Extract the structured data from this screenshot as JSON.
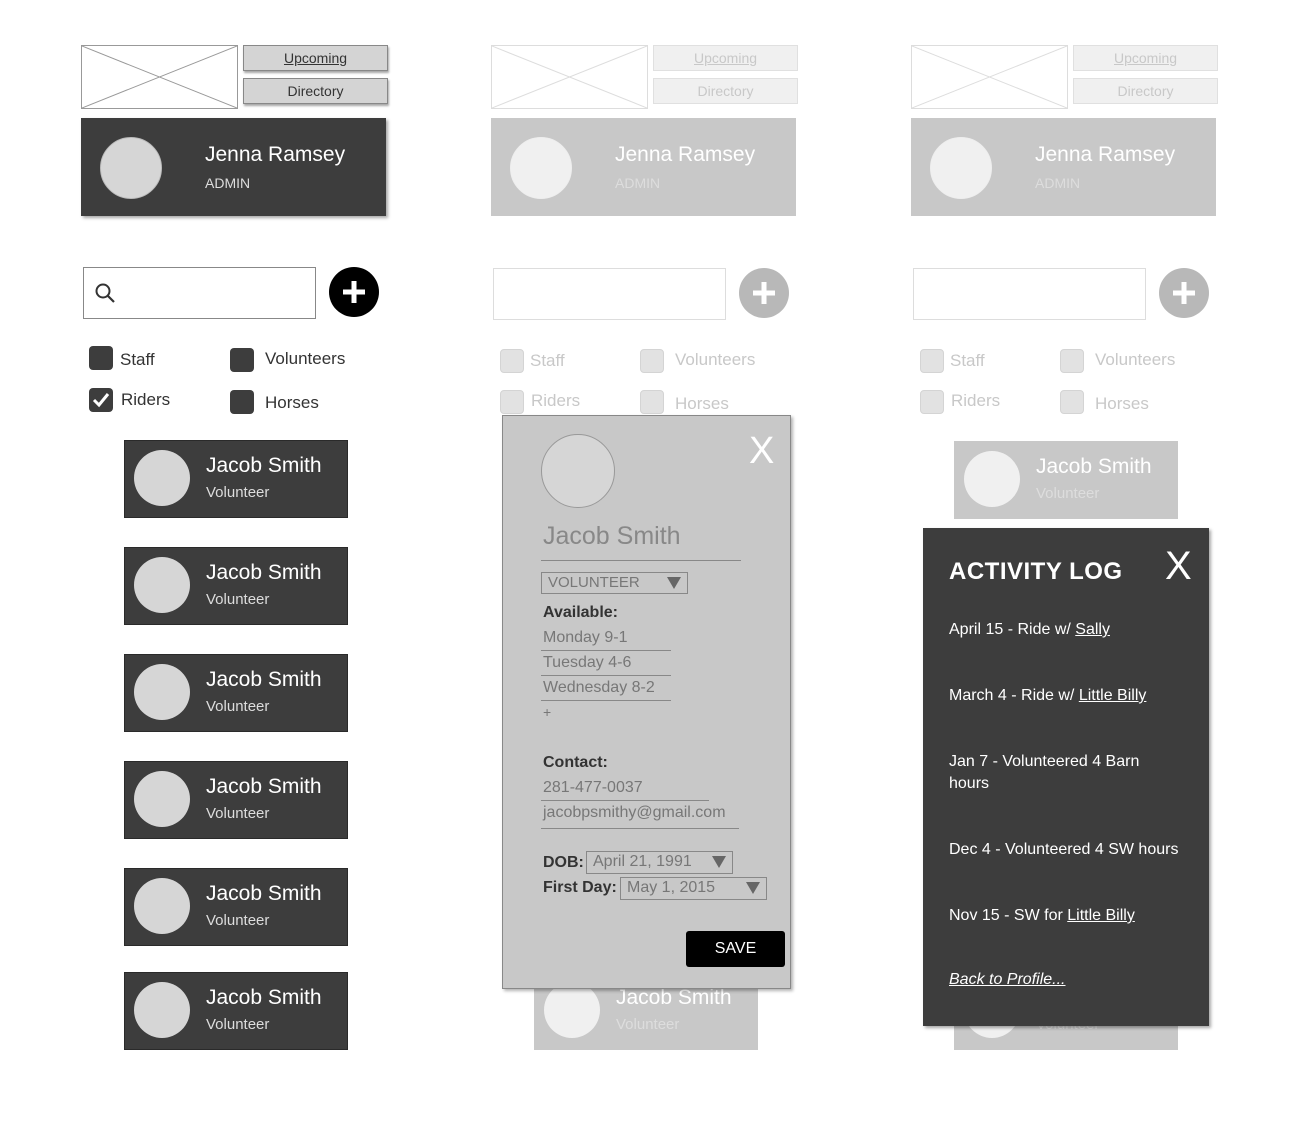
{
  "nav": {
    "upcoming": "Upcoming",
    "directory": "Directory"
  },
  "profile": {
    "name": "Jenna Ramsey",
    "role": "ADMIN"
  },
  "filters": {
    "staff": "Staff",
    "volunteers": "Volunteers",
    "riders": "Riders",
    "horses": "Horses",
    "riders_checked": true
  },
  "cards": [
    {
      "name": "Jacob Smith",
      "role": "Volunteer"
    },
    {
      "name": "Jacob Smith",
      "role": "Volunteer"
    },
    {
      "name": "Jacob Smith",
      "role": "Volunteer"
    },
    {
      "name": "Jacob Smith",
      "role": "Volunteer"
    },
    {
      "name": "Jacob Smith",
      "role": "Volunteer"
    },
    {
      "name": "Jacob Smith",
      "role": "Volunteer"
    }
  ],
  "edit": {
    "close": "X",
    "name": "Jacob Smith",
    "role_select": "VOLUNTEER",
    "available_label": "Available:",
    "availability": [
      "Monday 9-1",
      "Tuesday 4-6",
      "Wednesday 8-2"
    ],
    "add": "+",
    "contact_label": "Contact:",
    "phone": "281-477-0037",
    "email": "jacobpsmithy@gmail.com",
    "dob_label": "DOB:",
    "dob": "April 21, 1991",
    "first_day_label": "First Day:",
    "first_day": "May 1, 2015",
    "save": "SAVE"
  },
  "log": {
    "title": "ACTIVITY LOG",
    "close": "X",
    "entries": [
      {
        "text": "April 15 - Ride w/ ",
        "link": "Sally"
      },
      {
        "text": "March  4 - Ride w/ ",
        "link": "Little Billy"
      },
      {
        "text": "Jan 7 - Volunteered 4 Barn hours",
        "link": ""
      },
      {
        "text": "Dec 4 - Volunteered 4 SW hours",
        "link": ""
      },
      {
        "text": "Nov 15 - SW for ",
        "link": "Little Billy"
      }
    ],
    "back": "Back to Profile..."
  },
  "third_panel": {
    "partial_card_role": "Volunteer"
  }
}
